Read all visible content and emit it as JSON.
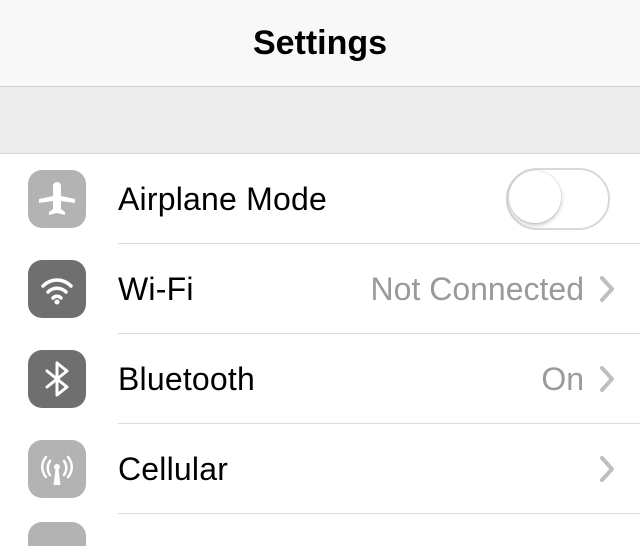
{
  "header": {
    "title": "Settings"
  },
  "rows": {
    "airplane": {
      "label": "Airplane Mode",
      "toggle_on": false
    },
    "wifi": {
      "label": "Wi-Fi",
      "value": "Not Connected"
    },
    "bluetooth": {
      "label": "Bluetooth",
      "value": "On"
    },
    "cellular": {
      "label": "Cellular"
    }
  }
}
